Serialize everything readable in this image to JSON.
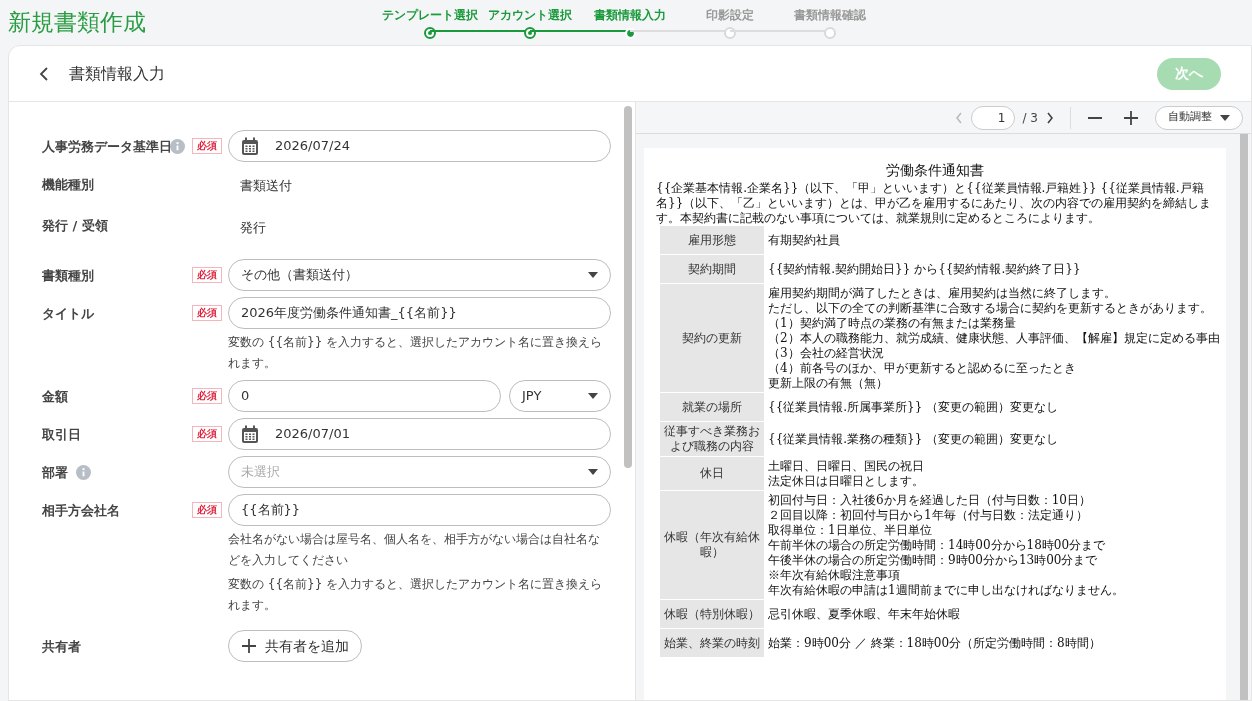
{
  "app_title": "新規書類作成",
  "steps": [
    {
      "label": "テンプレート選択",
      "completed": true,
      "selected": false
    },
    {
      "label": "アカウント選択",
      "completed": true,
      "selected": false
    },
    {
      "label": "書類情報入力",
      "completed": false,
      "selected": true
    },
    {
      "label": "印影設定",
      "completed": false,
      "selected": false
    },
    {
      "label": "書類情報確認",
      "completed": false,
      "selected": false
    }
  ],
  "page_header": {
    "title": "書類情報入力",
    "next_button": "次へ",
    "next_disabled": true
  },
  "form": {
    "fields": [
      {
        "label": "人事労務データ基準日",
        "info": true,
        "badge": "必須",
        "kind": "date",
        "value": "2026/07/24"
      },
      {
        "label": "機能種別",
        "info": false,
        "kind": "static",
        "value": "書類送付"
      },
      {
        "label": "発行 / 受領",
        "info": false,
        "kind": "static",
        "value": "発行"
      },
      {
        "label": "書類種別",
        "info": false,
        "badge": "必須",
        "kind": "select",
        "value": "その他（書類送付）"
      },
      {
        "label": "タイトル",
        "info": false,
        "badge": "必須",
        "kind": "text",
        "value": "2026年度労働条件通知書_{{名前}}",
        "hints": [
          "変数の {{名前}} を入力すると、選択したアカウント名に置き換えられます。"
        ]
      },
      {
        "label": "金額",
        "info": false,
        "badge": "必須",
        "kind": "amount",
        "value": "0",
        "currency": "JPY"
      },
      {
        "label": "取引日",
        "info": false,
        "badge": "必須",
        "kind": "date",
        "value": "2026/07/01"
      },
      {
        "label": "部署",
        "info": true,
        "kind": "select",
        "placeholder": "未選択"
      },
      {
        "label": "相手方会社名",
        "info": false,
        "badge": "必須",
        "kind": "text",
        "value": "{{名前}}",
        "hints": [
          "会社名がない場合は屋号名、個人名を、相手方がない場合は自社名などを入力してください",
          "変数の {{名前}} を入力すると、選択したアカウント名に置き換えられます。"
        ]
      },
      {
        "label": "共有者",
        "info": false,
        "kind": "add",
        "value": "共有者を追加"
      }
    ]
  },
  "preview": {
    "toolbar": {
      "page": "1",
      "page_total": "/ 3",
      "zoom": "自動調整"
    },
    "document": {
      "title": "労働条件通知書",
      "intro": "{{企業基本情報.企業名}}（以下、「甲」といいます）と{{従業員情報.戸籍姓}} {{従業員情報.戸籍名}}（以下、「乙」といいます）とは、甲が乙を雇用するにあたり、次の内容での雇用契約を締結します。本契約書に記載のない事項については、就業規則に定めるところによります。",
      "rows": [
        {
          "label": "雇用形態",
          "lines": [
            "有期契約社員"
          ]
        },
        {
          "label": "契約期間",
          "lines": [
            "{{契約情報.契約開始日}} から{{契約情報.契約終了日}}"
          ]
        },
        {
          "label": "契約の更新",
          "lines": [
            "雇用契約期間が満了したときは、雇用契約は当然に終了します。",
            "ただし、以下の全ての判断基準に合致する場合に契約を更新するときがあります。",
            "（1）契約満了時点の業務の有無または業務量",
            "（2）本人の職務能力、就労成績、健康状態、人事評価、【解雇】規定に定める事由",
            "（3）会社の経営状況",
            "（4）前各号のほか、甲が更新すると認めるに至ったとき",
            "更新上限の有無（無）"
          ]
        },
        {
          "label": "就業の場所",
          "lines": [
            "{{従業員情報.所属事業所}} （変更の範囲）変更なし"
          ]
        },
        {
          "label": "従事すべき業務および職務の内容",
          "lines": [
            "{{従業員情報.業務の種類}} （変更の範囲）変更なし"
          ]
        },
        {
          "label": "休日",
          "lines": [
            "土曜日、日曜日、国民の祝日",
            "法定休日は日曜日とします。"
          ]
        },
        {
          "label": "休暇（年次有給休暇）",
          "lines": [
            "初回付与日：入社後6か月を経過した日（付与日数：10日）",
            "２回目以降：初回付与日から1年毎（付与日数：法定通り）",
            "取得単位：1日単位、半日単位",
            "午前半休の場合の所定労働時間：14時00分から18時00分まで",
            "午後半休の場合の所定労働時間：9時00分から13時00分まで",
            "※年次有給休暇注意事項",
            "年次有給休暇の申請は1週間前までに申し出なければなりません。"
          ]
        },
        {
          "label": "休暇（特別休暇）",
          "lines": [
            "忌引休暇、夏季休暇、年末年始休暇"
          ]
        },
        {
          "label": "始業、終業の時刻",
          "lines": [
            "始業：9時00分 ／ 終業：18時00分（所定労働時間：8時間）"
          ]
        }
      ]
    }
  }
}
